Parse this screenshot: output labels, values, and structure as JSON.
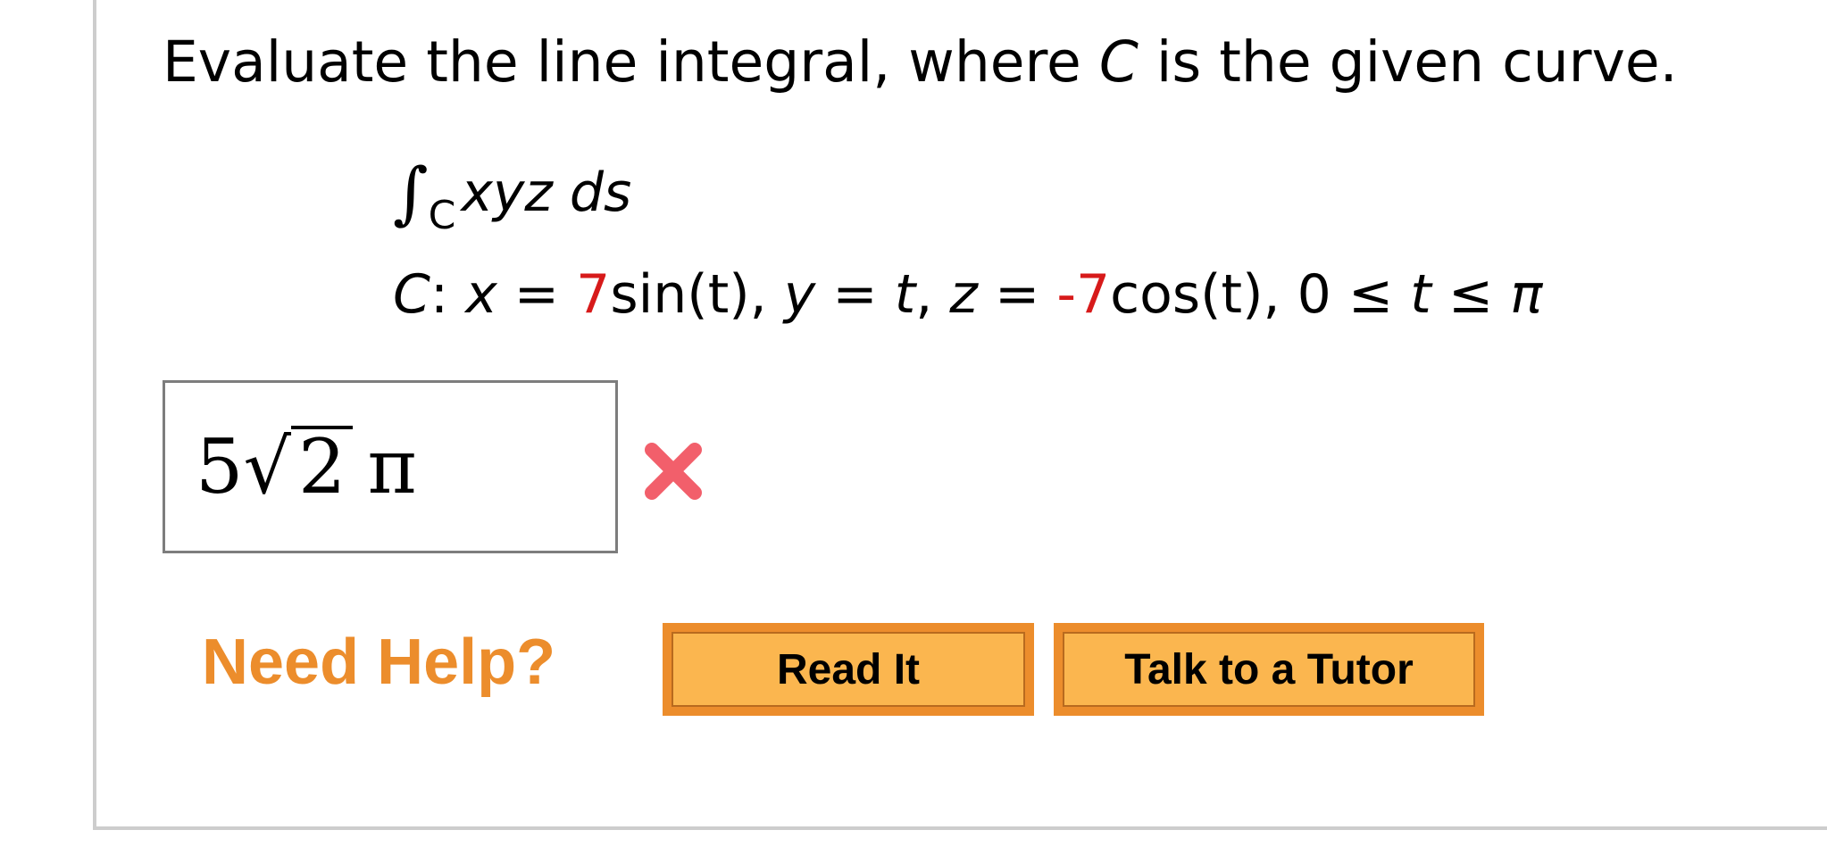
{
  "question": {
    "prefix": "Evaluate the line integral, where ",
    "curve_var": "C",
    "suffix": " is the given curve."
  },
  "integral": {
    "sign": "∫",
    "subscript": "C",
    "integrand": "xyz ds"
  },
  "curve": {
    "label": "C",
    "x_var": "x",
    "x_coef": "7",
    "x_func": "sin(t)",
    "y_var": "y",
    "y_expr": "t",
    "z_var": "z",
    "z_coef": "-7",
    "z_func": "cos(t)",
    "range_low": "0",
    "range_var": "t",
    "range_high": "π"
  },
  "answer": {
    "coefficient": "5",
    "radical_sign": "√",
    "radicand": "2",
    "pi": "π",
    "status": "incorrect",
    "status_color": "#f25f6b"
  },
  "help": {
    "label": "Need Help?",
    "read_it": "Read It",
    "tutor": "Talk to a Tutor",
    "accent_color": "#ec8d2c",
    "button_fill": "#fbb64f"
  }
}
